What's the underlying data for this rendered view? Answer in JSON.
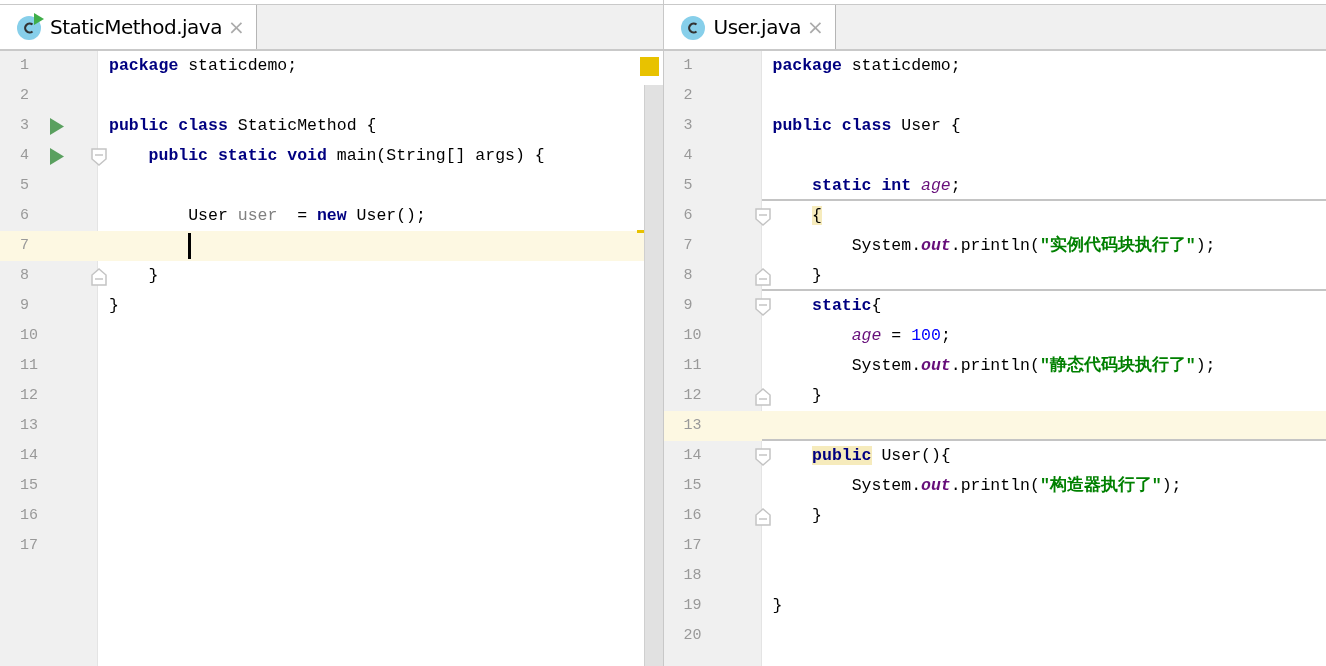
{
  "panes": [
    {
      "tab": {
        "label": "StaticMethod.java",
        "close": "×",
        "selected": true,
        "runnable": true
      },
      "scrollbar": true,
      "lines": [
        {
          "number": "1",
          "tokens": [
            {
              "text": "package",
              "kind": "kw"
            },
            {
              "text": " staticdemo;",
              "kind": "plain"
            }
          ]
        },
        {
          "number": "2"
        },
        {
          "number": "3",
          "run": true,
          "tokens": [
            {
              "text": "public class",
              "kind": "kw"
            },
            {
              "text": " StaticMethod {",
              "kind": "plain"
            }
          ]
        },
        {
          "number": "4",
          "run": true,
          "fold_start": true,
          "tokens": [
            {
              "text": "    public static void",
              "kind": "kw"
            },
            {
              "text": " main(String[] args) {",
              "kind": "plain"
            }
          ]
        },
        {
          "number": "5"
        },
        {
          "number": "6",
          "marker": true,
          "tokens": [
            {
              "text": "        User ",
              "kind": "plain"
            },
            {
              "text": "user",
              "kind": "unused"
            },
            {
              "text": "  = ",
              "kind": "plain"
            },
            {
              "text": "new",
              "kind": "kw"
            },
            {
              "text": " User();",
              "kind": "plain"
            }
          ]
        },
        {
          "number": "7",
          "current": true,
          "caret": true
        },
        {
          "number": "8",
          "fold_end": true,
          "tokens": [
            {
              "text": "    }",
              "kind": "plain"
            }
          ]
        },
        {
          "number": "9",
          "tokens": [
            {
              "text": "}",
              "kind": "plain"
            }
          ]
        },
        {
          "number": "10"
        },
        {
          "number": "11"
        },
        {
          "number": "12"
        },
        {
          "number": "13"
        },
        {
          "number": "14"
        },
        {
          "number": "15"
        },
        {
          "number": "16"
        },
        {
          "number": "17"
        }
      ]
    },
    {
      "tab": {
        "label": "User.java",
        "close": "×",
        "selected": true,
        "runnable": false
      },
      "scrollbar": false,
      "lines": [
        {
          "number": "1",
          "tokens": [
            {
              "text": "package",
              "kind": "kw"
            },
            {
              "text": " staticdemo;",
              "kind": "plain"
            }
          ]
        },
        {
          "number": "2"
        },
        {
          "number": "3",
          "tokens": [
            {
              "text": "public class",
              "kind": "kw"
            },
            {
              "text": " User {",
              "kind": "plain"
            }
          ]
        },
        {
          "number": "4"
        },
        {
          "number": "5",
          "separator": true,
          "tokens": [
            {
              "text": "    static int ",
              "kind": "kw"
            },
            {
              "text": "age",
              "kind": "field"
            },
            {
              "text": ";",
              "kind": "plain"
            }
          ]
        },
        {
          "number": "6",
          "fold_start": true,
          "tokens": [
            {
              "text": "    {",
              "kind": "plain",
              "highlight": true
            }
          ]
        },
        {
          "number": "7",
          "tokens": [
            {
              "text": "        System.",
              "kind": "plain"
            },
            {
              "text": "out",
              "kind": "static"
            },
            {
              "text": ".println(",
              "kind": "plain"
            },
            {
              "text": "\"实例代码块执行了\"",
              "kind": "string"
            },
            {
              "text": ");",
              "kind": "plain"
            }
          ]
        },
        {
          "number": "8",
          "fold_end": true,
          "separator": true,
          "tokens": [
            {
              "text": "    }",
              "kind": "plain"
            }
          ]
        },
        {
          "number": "9",
          "fold_start": true,
          "tokens": [
            {
              "text": "    static",
              "kind": "kw"
            },
            {
              "text": "{",
              "kind": "plain"
            }
          ]
        },
        {
          "number": "10",
          "tokens": [
            {
              "text": "        age",
              "kind": "field"
            },
            {
              "text": " = ",
              "kind": "plain"
            },
            {
              "text": "100",
              "kind": "num"
            },
            {
              "text": ";",
              "kind": "plain"
            }
          ]
        },
        {
          "number": "11",
          "tokens": [
            {
              "text": "        System.",
              "kind": "plain"
            },
            {
              "text": "out",
              "kind": "static"
            },
            {
              "text": ".println(",
              "kind": "plain"
            },
            {
              "text": "\"静态代码块执行了\"",
              "kind": "string"
            },
            {
              "text": ");",
              "kind": "plain"
            }
          ]
        },
        {
          "number": "12",
          "fold_end": true,
          "tokens": [
            {
              "text": "    }",
              "kind": "plain"
            }
          ]
        },
        {
          "number": "13",
          "current": true,
          "separator": true
        },
        {
          "number": "14",
          "fold_start": true,
          "tokens": [
            {
              "text": "    public",
              "kind": "kw",
              "highlight": true
            },
            {
              "text": " User(){",
              "kind": "plain"
            }
          ]
        },
        {
          "number": "15",
          "tokens": [
            {
              "text": "        System.",
              "kind": "plain"
            },
            {
              "text": "out",
              "kind": "static"
            },
            {
              "text": ".println(",
              "kind": "plain"
            },
            {
              "text": "\"构造器执行了\"",
              "kind": "string"
            },
            {
              "text": ");",
              "kind": "plain"
            }
          ]
        },
        {
          "number": "16",
          "fold_end": true,
          "tokens": [
            {
              "text": "    }",
              "kind": "plain"
            }
          ]
        },
        {
          "number": "17"
        },
        {
          "number": "18"
        },
        {
          "number": "19",
          "tokens": [
            {
              "text": "}",
              "kind": "plain"
            }
          ]
        },
        {
          "number": "20"
        }
      ]
    }
  ]
}
